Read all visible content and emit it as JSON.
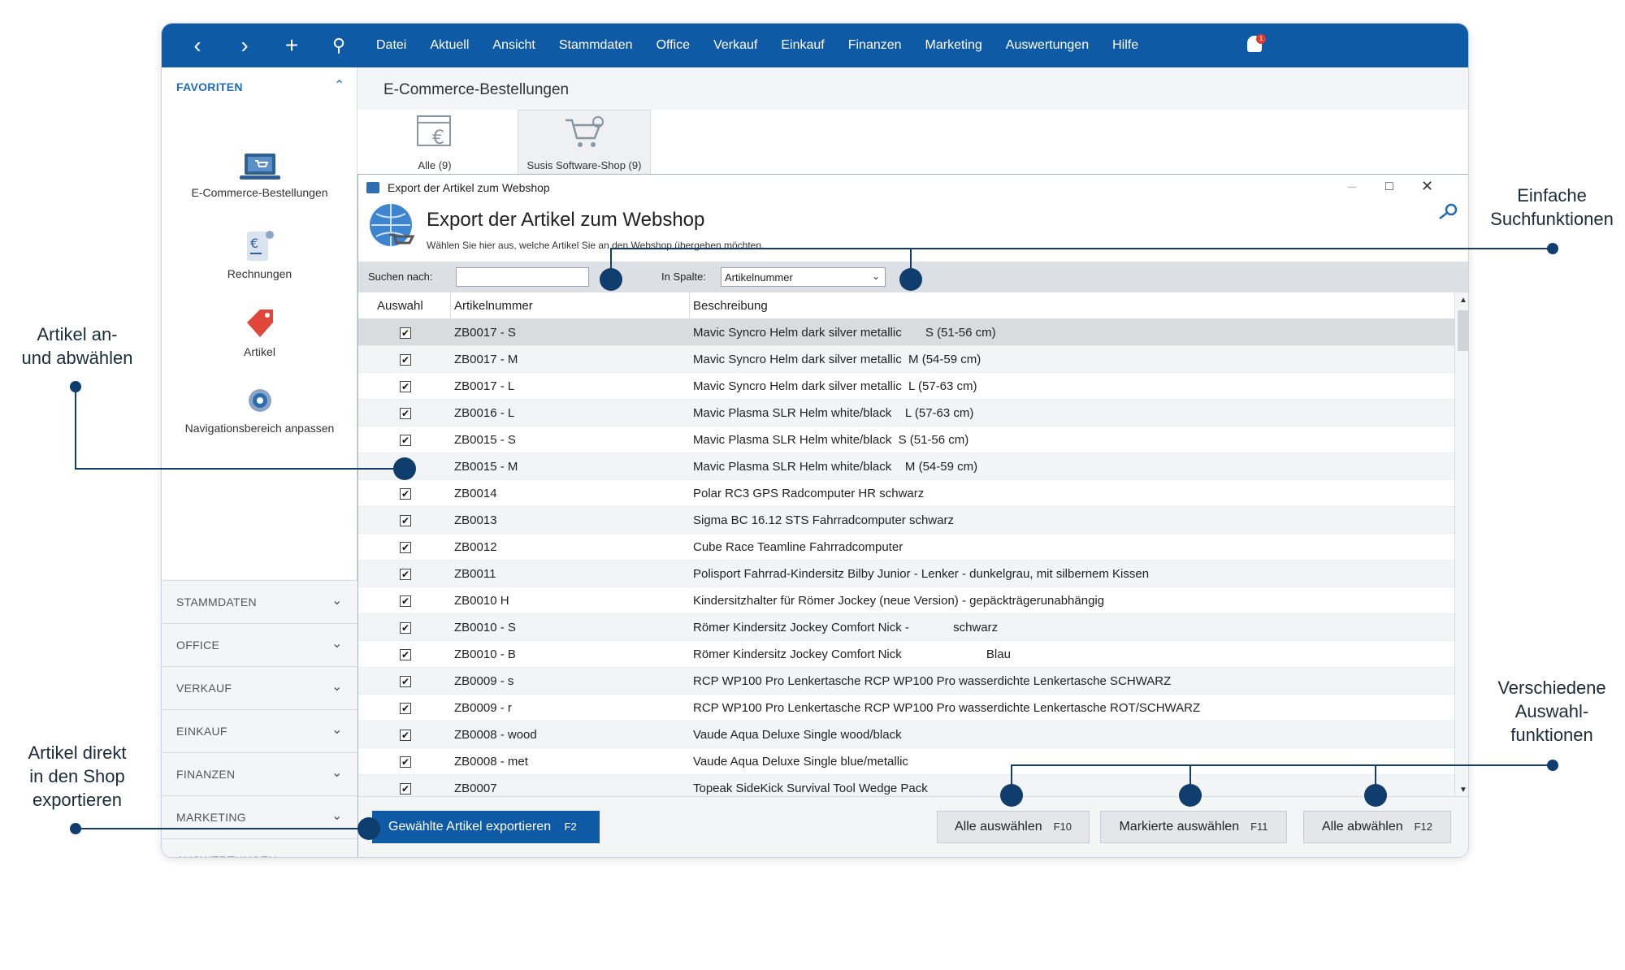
{
  "topbar": {
    "nav_icons": [
      "chevron-left-icon",
      "chevron-right-icon",
      "plus-icon",
      "search-icon"
    ],
    "menu": [
      "Datei",
      "Aktuell",
      "Ansicht",
      "Stammdaten",
      "Office",
      "Verkauf",
      "Einkauf",
      "Finanzen",
      "Marketing",
      "Auswertungen",
      "Hilfe"
    ],
    "notification_count": "1",
    "brand_color": "#0f5aa6"
  },
  "sidebar": {
    "favorites_title": "FAVORITEN",
    "favorites": [
      {
        "label": "E-Commerce-Bestellungen",
        "icon": "laptop-cart-icon"
      },
      {
        "label": "Rechnungen",
        "icon": "invoice-euro-icon"
      },
      {
        "label": "Artikel",
        "icon": "price-tag-icon"
      },
      {
        "label": "Navigationsbereich anpassen",
        "icon": "gear-icon"
      }
    ],
    "sections": [
      "STAMMDATEN",
      "OFFICE",
      "VERKAUF",
      "EINKAUF",
      "FINANZEN",
      "MARKETING",
      "AUSWERTUNGEN"
    ]
  },
  "content": {
    "title": "E-Commerce-Bestellungen",
    "tabs": [
      {
        "label": "Alle (9)",
        "icon": "euro-window-icon"
      },
      {
        "label": "Susis Software-Shop (9)",
        "icon": "shopping-cart-icon"
      }
    ]
  },
  "dialog": {
    "window_title": "Export der Artikel zum Webshop",
    "heading": "Export der Artikel zum Webshop",
    "subtitle": "Wählen Sie hier aus, welche Artikel Sie an den Webshop übergeben möchten.",
    "search_label": "Suchen nach:",
    "search_value": "",
    "column_label": "In Spalte:",
    "column_value": "Artikelnummer",
    "columns": [
      "Auswahl",
      "Artikelnummer",
      "Beschreibung"
    ],
    "rows": [
      {
        "nr": "ZB0017 - S",
        "desc": "Mavic Syncro Helm dark silver metallic       S (51-56 cm)",
        "checked": true
      },
      {
        "nr": "ZB0017 - M",
        "desc": "Mavic Syncro Helm dark silver metallic  M (54-59 cm)",
        "checked": true
      },
      {
        "nr": "ZB0017 - L",
        "desc": "Mavic Syncro Helm dark silver metallic  L (57-63 cm)",
        "checked": true
      },
      {
        "nr": "ZB0016 - L",
        "desc": "Mavic Plasma SLR Helm white/black    L (57-63 cm)",
        "checked": true
      },
      {
        "nr": "ZB0015 - S",
        "desc": "Mavic Plasma SLR Helm white/black  S (51-56 cm)",
        "checked": true
      },
      {
        "nr": "ZB0015 - M",
        "desc": "Mavic Plasma SLR Helm white/black    M (54-59 cm)",
        "checked": true
      },
      {
        "nr": "ZB0014",
        "desc": "Polar RC3 GPS Radcomputer HR schwarz",
        "checked": true
      },
      {
        "nr": "ZB0013",
        "desc": "Sigma BC 16.12 STS Fahrradcomputer schwarz",
        "checked": true
      },
      {
        "nr": "ZB0012",
        "desc": "Cube Race Teamline Fahrradcomputer",
        "checked": true
      },
      {
        "nr": "ZB0011",
        "desc": "Polisport Fahrrad-Kindersitz Bilby Junior - Lenker - dunkelgrau, mit silbernem Kissen",
        "checked": true
      },
      {
        "nr": "ZB0010 H",
        "desc": "Kindersitzhalter für Römer Jockey (neue Version) - gepäckträgerunabhängig",
        "checked": true
      },
      {
        "nr": "ZB0010 - S",
        "desc": "Römer Kindersitz Jockey Comfort Nick -             schwarz",
        "checked": true
      },
      {
        "nr": "ZB0010 - B",
        "desc": "Römer Kindersitz Jockey Comfort Nick                         Blau",
        "checked": true
      },
      {
        "nr": "ZB0009 - s",
        "desc": "RCP WP100 Pro Lenkertasche RCP WP100 Pro wasserdichte Lenkertasche SCHWARZ",
        "checked": true
      },
      {
        "nr": "ZB0009 - r",
        "desc": "RCP WP100 Pro Lenkertasche RCP WP100 Pro wasserdichte Lenkertasche ROT/SCHWARZ",
        "checked": true
      },
      {
        "nr": "ZB0008 - wood",
        "desc": "Vaude Aqua Deluxe Single wood/black",
        "checked": true
      },
      {
        "nr": "ZB0008 - met",
        "desc": "Vaude Aqua Deluxe Single blue/metallic",
        "checked": true
      },
      {
        "nr": "ZB0007",
        "desc": "Topeak SideKick Survival Tool Wedge Pack",
        "checked": true
      }
    ],
    "buttons": {
      "export": {
        "label": "Gewählte Artikel exportieren",
        "key": "F2"
      },
      "select_all": {
        "label": "Alle auswählen",
        "key": "F10"
      },
      "select_marked": {
        "label": "Markierte auswählen",
        "key": "F11"
      },
      "deselect_all": {
        "label": "Alle abwählen",
        "key": "F12"
      }
    }
  },
  "annotations": {
    "search": [
      "Einfache",
      "Suchfunktionen"
    ],
    "select": [
      "Artikel an-",
      "und abwählen"
    ],
    "export": [
      "Artikel direkt",
      "in den Shop",
      "exportieren"
    ],
    "selection": [
      "Verschiedene",
      "Auswahl-",
      "funktionen"
    ],
    "color": "#0f3d6e"
  }
}
